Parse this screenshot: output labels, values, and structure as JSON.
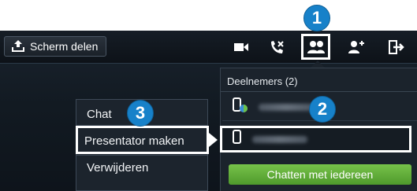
{
  "toolbar": {
    "share_label": "Scherm delen",
    "icons": [
      "share-upload-icon",
      "video-camera-icon",
      "end-call-icon",
      "participants-icon",
      "add-participant-icon",
      "exit-icon"
    ]
  },
  "callouts": [
    "1",
    "2",
    "3"
  ],
  "participants_panel": {
    "title": "Deelnemers (2)",
    "rows": [
      {
        "icon": "phone-with-status-icon"
      },
      {
        "icon": "phone-icon"
      }
    ],
    "chat_all_label": "Chatten met iedereen"
  },
  "context_menu": {
    "items": [
      "Chat",
      "Presentator maken",
      "Verwijderen"
    ]
  },
  "colors": {
    "callout_blue": "#1781c9",
    "chat_green": "#5fae39",
    "highlight": "#ffffff",
    "background": "#121a22"
  }
}
